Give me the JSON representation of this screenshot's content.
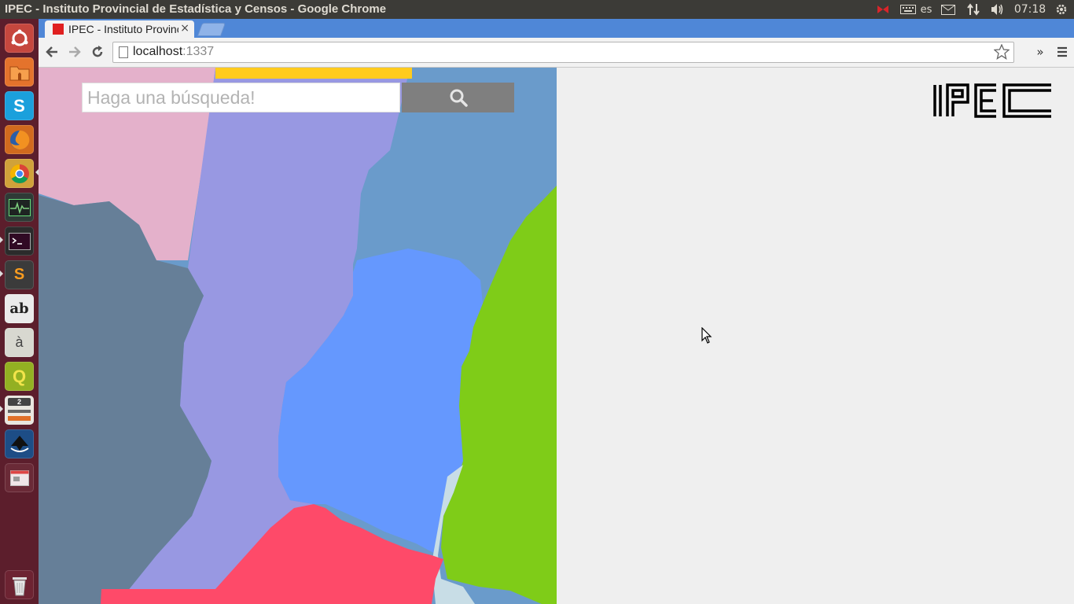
{
  "window": {
    "title": "IPEC - Instituto Provincial de Estadística y Censos - Google Chrome"
  },
  "top_panel": {
    "keyboard_layout": "es",
    "clock": "07:18"
  },
  "launcher": {
    "items": [
      {
        "name": "dash",
        "glyph": ""
      },
      {
        "name": "files",
        "glyph": ""
      },
      {
        "name": "skype",
        "glyph": "S"
      },
      {
        "name": "firefox",
        "glyph": ""
      },
      {
        "name": "chrome",
        "glyph": ""
      },
      {
        "name": "system-monitor",
        "glyph": ""
      },
      {
        "name": "terminal",
        "glyph": ""
      },
      {
        "name": "sublime-text",
        "glyph": "S"
      },
      {
        "name": "font-viewer",
        "glyph": "ab"
      },
      {
        "name": "character-map",
        "glyph": "à"
      },
      {
        "name": "qgis",
        "glyph": "Q"
      },
      {
        "name": "workspace",
        "glyph": "2"
      },
      {
        "name": "inkscape",
        "glyph": ""
      },
      {
        "name": "window-app",
        "glyph": ""
      },
      {
        "name": "trash",
        "glyph": ""
      }
    ]
  },
  "browser": {
    "tab_title": "IPEC - Instituto Provincial de Estadística y Censos",
    "tab_close": "×",
    "url_host": "localhost",
    "url_port": ":1337",
    "extensions_label": "»"
  },
  "page": {
    "search_placeholder": "Haga una búsqueda!",
    "logo_text": "IPEC"
  },
  "colors": {
    "map_pink": "#e4b1cb",
    "map_lavender": "#9898e2",
    "map_steel_blue": "#6a9bcb",
    "map_slate": "#667f98",
    "map_bright_blue": "#6598fe",
    "map_green": "#7fcc18",
    "map_red": "#fe4a69",
    "map_yellow": "#ffcb1d",
    "map_pale": "#c8dde6",
    "search_button": "#7f7f7f",
    "page_background": "#efefef"
  }
}
